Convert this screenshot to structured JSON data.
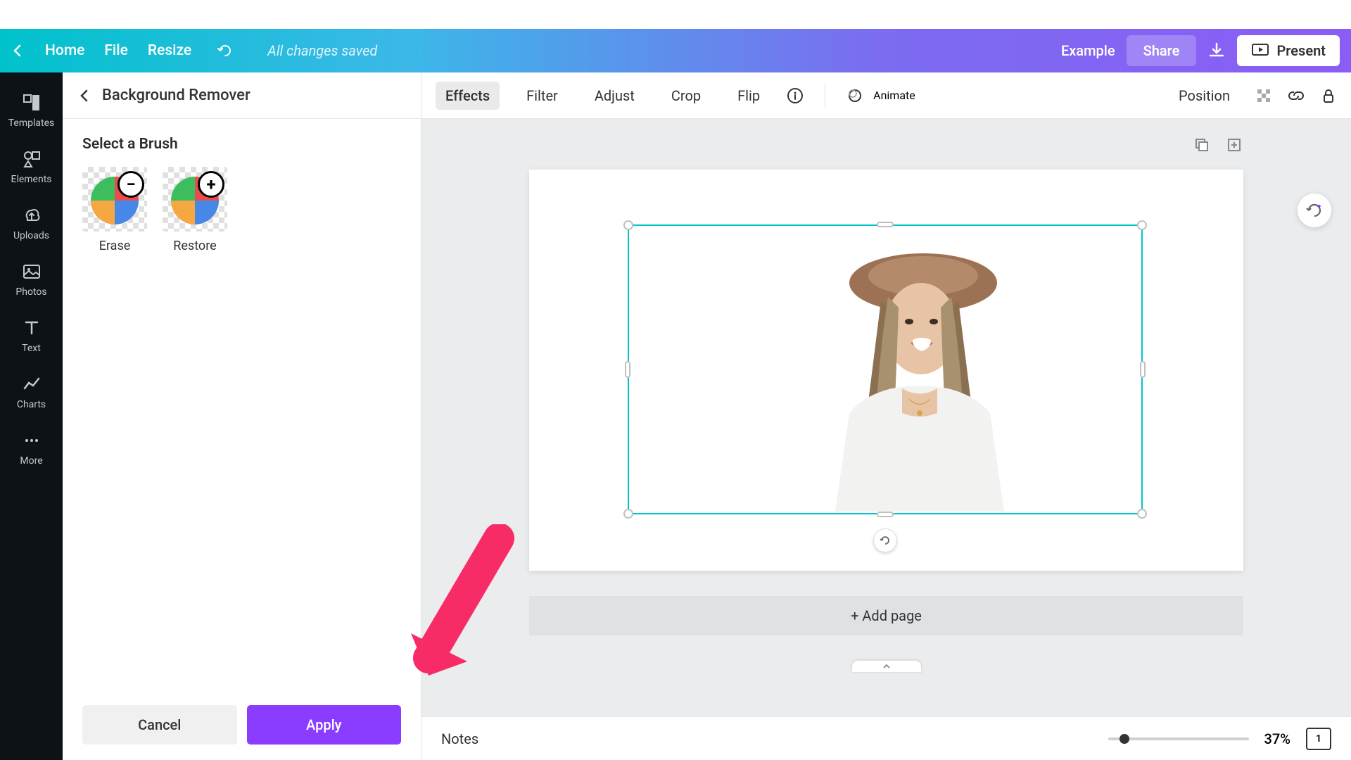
{
  "header": {
    "home": "Home",
    "file": "File",
    "resize": "Resize",
    "save_status": "All changes saved",
    "example": "Example",
    "share": "Share",
    "present": "Present"
  },
  "sidebar": {
    "items": [
      {
        "label": "Templates",
        "icon": "templates"
      },
      {
        "label": "Elements",
        "icon": "elements"
      },
      {
        "label": "Uploads",
        "icon": "uploads"
      },
      {
        "label": "Photos",
        "icon": "photos"
      },
      {
        "label": "Text",
        "icon": "text"
      },
      {
        "label": "Charts",
        "icon": "charts"
      },
      {
        "label": "More",
        "icon": "more"
      }
    ]
  },
  "panel": {
    "title": "Background Remover",
    "section_title": "Select a Brush",
    "brushes": [
      {
        "label": "Erase",
        "symbol": "−"
      },
      {
        "label": "Restore",
        "symbol": "+"
      }
    ],
    "cancel": "Cancel",
    "apply": "Apply"
  },
  "toolbar": {
    "effects": "Effects",
    "filter": "Filter",
    "adjust": "Adjust",
    "crop": "Crop",
    "flip": "Flip",
    "animate": "Animate",
    "position": "Position"
  },
  "canvas": {
    "add_page": "+ Add page"
  },
  "bottom": {
    "notes": "Notes",
    "zoom": "37%",
    "page_count": "1"
  }
}
